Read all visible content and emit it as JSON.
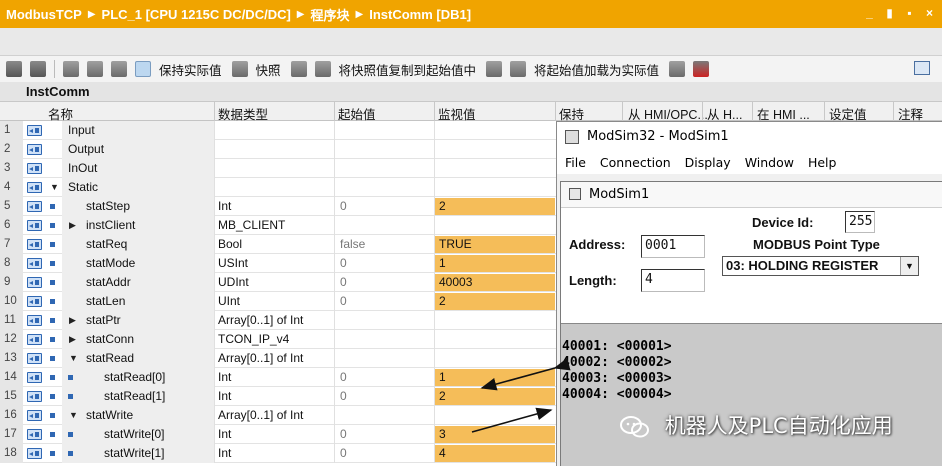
{
  "breadcrumb": [
    "ModbusTCP",
    "PLC_1 [CPU 1215C DC/DC/DC]",
    "程序块",
    "InstComm [DB1]"
  ],
  "window_controls": [
    "_",
    "▮",
    "▪",
    "×"
  ],
  "toolbar": {
    "keep_actual": "保持实际值",
    "snapshot": "快照",
    "copy_snapshot": "将快照值复制到起始值中",
    "load_start": "将起始值加载为实际值"
  },
  "block_name": "InstComm",
  "columns": {
    "name": "名称",
    "datatype": "数据类型",
    "start": "起始值",
    "monitor": "监视值",
    "retain": "保持",
    "hmi_opc": "从 HMI/OPC...",
    "hmi_h": "从 H...",
    "in_hmi": "在 HMI ...",
    "setpoint": "设定值",
    "comment": "注释"
  },
  "rows": [
    {
      "num": "1",
      "name": "Input",
      "datatype": "",
      "start": "",
      "monitor": ""
    },
    {
      "num": "2",
      "name": "Output",
      "datatype": "",
      "start": "",
      "monitor": ""
    },
    {
      "num": "3",
      "name": "InOut",
      "datatype": "",
      "start": "",
      "monitor": ""
    },
    {
      "num": "4",
      "name": "Static",
      "datatype": "",
      "start": "",
      "monitor": ""
    },
    {
      "num": "5",
      "name": "statStep",
      "datatype": "Int",
      "start": "0",
      "monitor": "2"
    },
    {
      "num": "6",
      "name": "instClient",
      "datatype": "MB_CLIENT",
      "start": "",
      "monitor": ""
    },
    {
      "num": "7",
      "name": "statReq",
      "datatype": "Bool",
      "start": "false",
      "monitor": "TRUE"
    },
    {
      "num": "8",
      "name": "statMode",
      "datatype": "USInt",
      "start": "0",
      "monitor": "1"
    },
    {
      "num": "9",
      "name": "statAddr",
      "datatype": "UDInt",
      "start": "0",
      "monitor": "40003"
    },
    {
      "num": "10",
      "name": "statLen",
      "datatype": "UInt",
      "start": "0",
      "monitor": "2"
    },
    {
      "num": "11",
      "name": "statPtr",
      "datatype": "Array[0..1] of Int",
      "start": "",
      "monitor": ""
    },
    {
      "num": "12",
      "name": "statConn",
      "datatype": "TCON_IP_v4",
      "start": "",
      "monitor": ""
    },
    {
      "num": "13",
      "name": "statRead",
      "datatype": "Array[0..1] of Int",
      "start": "",
      "monitor": ""
    },
    {
      "num": "14",
      "name": "statRead[0]",
      "datatype": "Int",
      "start": "0",
      "monitor": "1"
    },
    {
      "num": "15",
      "name": "statRead[1]",
      "datatype": "Int",
      "start": "0",
      "monitor": "2"
    },
    {
      "num": "16",
      "name": "statWrite",
      "datatype": "Array[0..1] of Int",
      "start": "",
      "monitor": ""
    },
    {
      "num": "17",
      "name": "statWrite[0]",
      "datatype": "Int",
      "start": "0",
      "monitor": "3"
    },
    {
      "num": "18",
      "name": "statWrite[1]",
      "datatype": "Int",
      "start": "0",
      "monitor": "4"
    }
  ],
  "modsim": {
    "title": "ModSim32 - ModSim1",
    "menu": [
      "File",
      "Connection",
      "Display",
      "Window",
      "Help"
    ],
    "child_title": "ModSim1",
    "device_id_label": "Device Id:",
    "device_id": "255",
    "point_type_label": "MODBUS Point Type",
    "point_type": "03: HOLDING REGISTER",
    "address_label": "Address:",
    "address": "0001",
    "length_label": "Length:",
    "length": "4",
    "registers": [
      "40001: <00001>",
      "40002: <00002>",
      "40003: <00003>",
      "40004: <00004>"
    ]
  },
  "watermark": "机器人及PLC自动化应用"
}
